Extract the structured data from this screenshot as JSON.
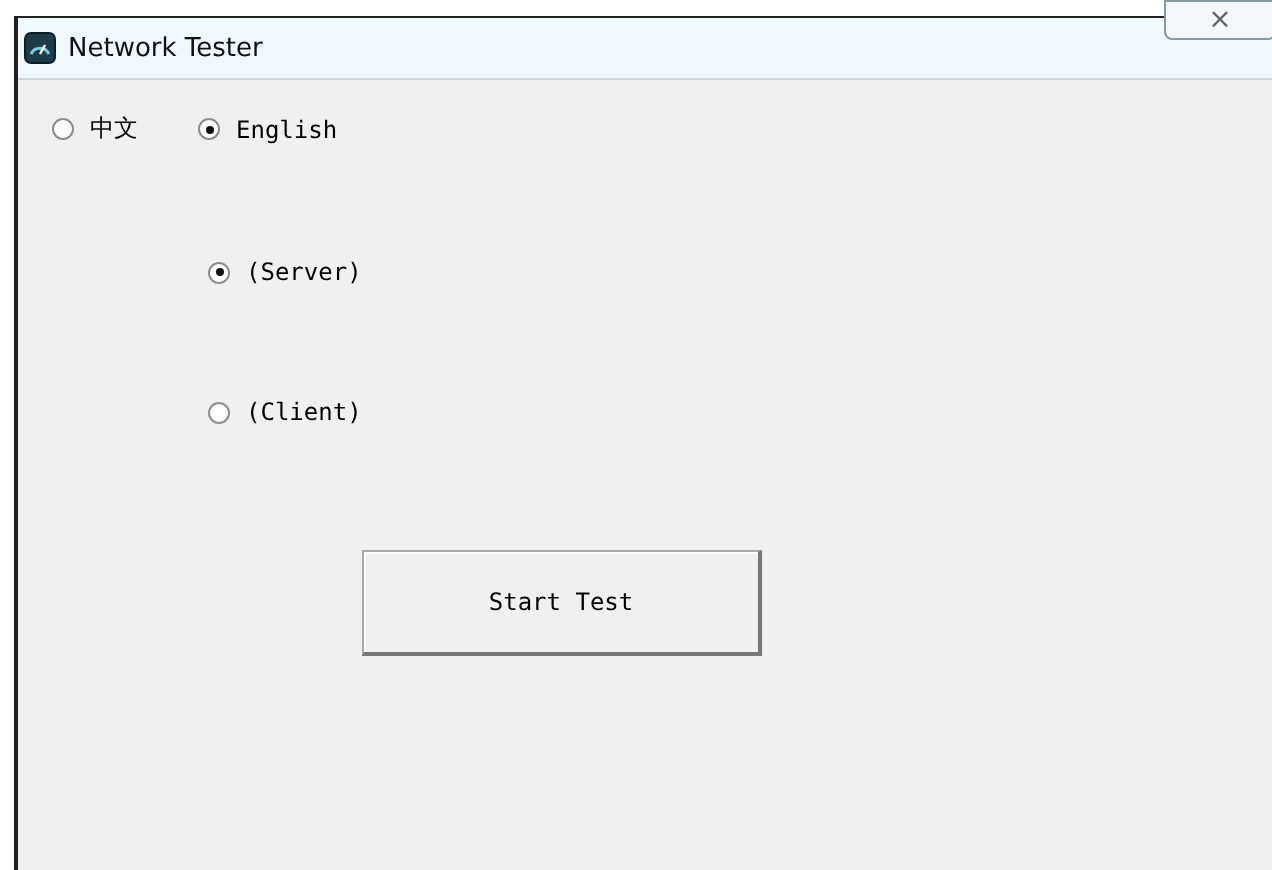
{
  "window": {
    "title": "Network Tester",
    "close": "×"
  },
  "languages": [
    {
      "label": "中文",
      "selected": false
    },
    {
      "label": "English",
      "selected": true
    }
  ],
  "modes": [
    {
      "label": "(Server)",
      "selected": true
    },
    {
      "label": "(Client)",
      "selected": false
    }
  ],
  "button": "Start Test"
}
